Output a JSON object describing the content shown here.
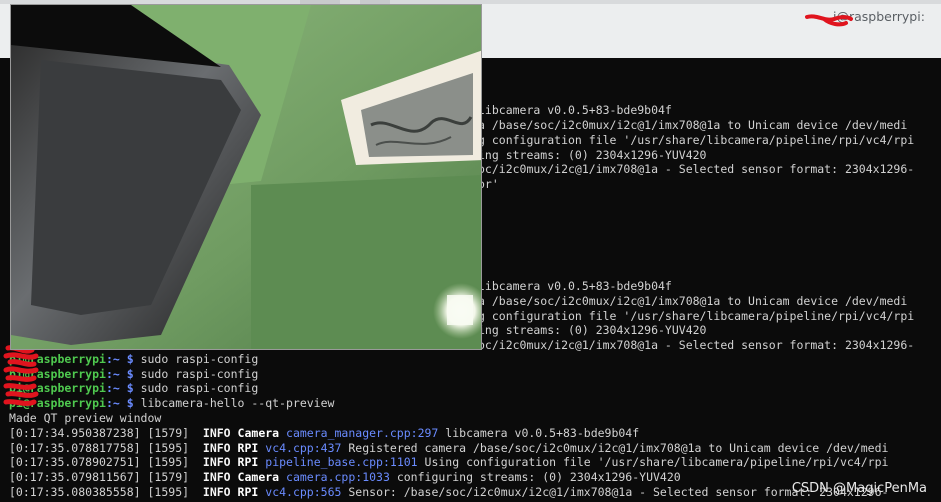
{
  "window": {
    "title": "i@raspberrypi:"
  },
  "background_lines": [
    "libcamera v0.0.5+83-bde9b04f",
    "a /base/soc/i2c0mux/i2c@1/imx708@1a to Unicam device /dev/medi",
    "g configuration file '/usr/share/libcamera/pipeline/rpi/vc4/rpi",
    "ing streams: (0) 2304x1296-YUV420",
    "oc/i2c0mux/i2c@1/imx708@1a - Selected sensor format: 2304x1296-",
    "or'",
    "libcamera v0.0.5+83-bde9b04f",
    "a /base/soc/i2c0mux/i2c@1/imx708@1a to Unicam device /dev/medi",
    "g configuration file '/usr/share/libcamera/pipeline/rpi/vc4/rpi",
    "ing streams: (0) 2304x1296-YUV420",
    "oc/i2c0mux/i2c@1/imx708@1a - Selected sensor format: 2304x1296-"
  ],
  "prompts": [
    {
      "user": "pi@raspberrypi",
      "path": ":~",
      "symbol": " $ ",
      "command": "sudo raspi-config"
    },
    {
      "user": "pi@raspberrypi",
      "path": ":~",
      "symbol": " $ ",
      "command": "sudo raspi-config"
    },
    {
      "user": "pi@raspberrypi",
      "path": ":~",
      "symbol": " $ ",
      "command": "sudo raspi-config"
    },
    {
      "user": "pi@raspberrypi",
      "path": ":~",
      "symbol": " $ ",
      "command": "libcamera-hello --qt-preview"
    }
  ],
  "preview_notice": "Made QT preview window",
  "log_lines": [
    {
      "ts": "[0:17:34.950387238]",
      "pid": "[1579]",
      "level": "INFO",
      "comp": "Camera",
      "src": "camera_manager.cpp:297",
      "msg": "libcamera v0.0.5+83-bde9b04f"
    },
    {
      "ts": "[0:17:35.078817758]",
      "pid": "[1595]",
      "level": "INFO",
      "comp": "RPI",
      "src": "vc4.cpp:437",
      "msg": "Registered camera /base/soc/i2c0mux/i2c@1/imx708@1a to Unicam device /dev/medi"
    },
    {
      "ts": "[0:17:35.078902751]",
      "pid": "[1595]",
      "level": "INFO",
      "comp": "RPI",
      "src": "pipeline_base.cpp:1101",
      "msg": "Using configuration file '/usr/share/libcamera/pipeline/rpi/vc4/rpi"
    },
    {
      "ts": "[0:17:35.079811567]",
      "pid": "[1579]",
      "level": "INFO",
      "comp": "Camera",
      "src": "camera.cpp:1033",
      "msg": "configuring streams: (0) 2304x1296-YUV420"
    },
    {
      "ts": "[0:17:35.080385558]",
      "pid": "[1595]",
      "level": "INFO",
      "comp": "RPI",
      "src": "vc4.cpp:565",
      "msg": "Sensor: /base/soc/i2c0mux/i2c@1/imx708@1a - Selected sensor format: 2304x1296-"
    }
  ],
  "watermark": "CSDN @MagicPenMa",
  "colors": {
    "prompt_user": "#4fc94f",
    "prompt_path": "#6a8bff",
    "redaction": "#e0141e"
  }
}
